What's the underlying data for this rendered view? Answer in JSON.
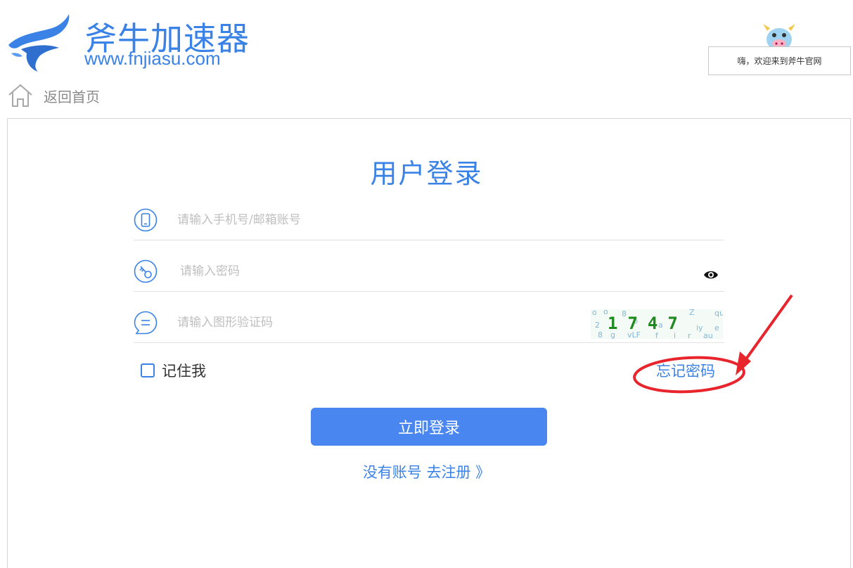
{
  "brand": {
    "name": "斧牛加速器",
    "url": "www.fnjiasu.com",
    "color": "#3a82e6"
  },
  "welcome": {
    "text": "嗨，欢迎来到斧牛官网"
  },
  "nav": {
    "back_home": "返回首页"
  },
  "login": {
    "title": "用户登录",
    "account_placeholder": "请输入手机号/邮箱账号",
    "password_placeholder": "请输入密码",
    "captcha_placeholder": "请输入图形验证码",
    "captcha_code": "1747",
    "remember_label": "记住我",
    "forgot_label": "忘记密码",
    "submit_label": "立即登录",
    "register_label": "没有账号 去注册 》"
  },
  "colors": {
    "accent": "#3a82e6",
    "button": "#4a86f0",
    "annotation": "#e8242c"
  },
  "icons": {
    "account": "phone-icon",
    "password": "key-icon",
    "captcha": "chat-icon",
    "show_password": "eye-icon",
    "home": "home-icon"
  }
}
